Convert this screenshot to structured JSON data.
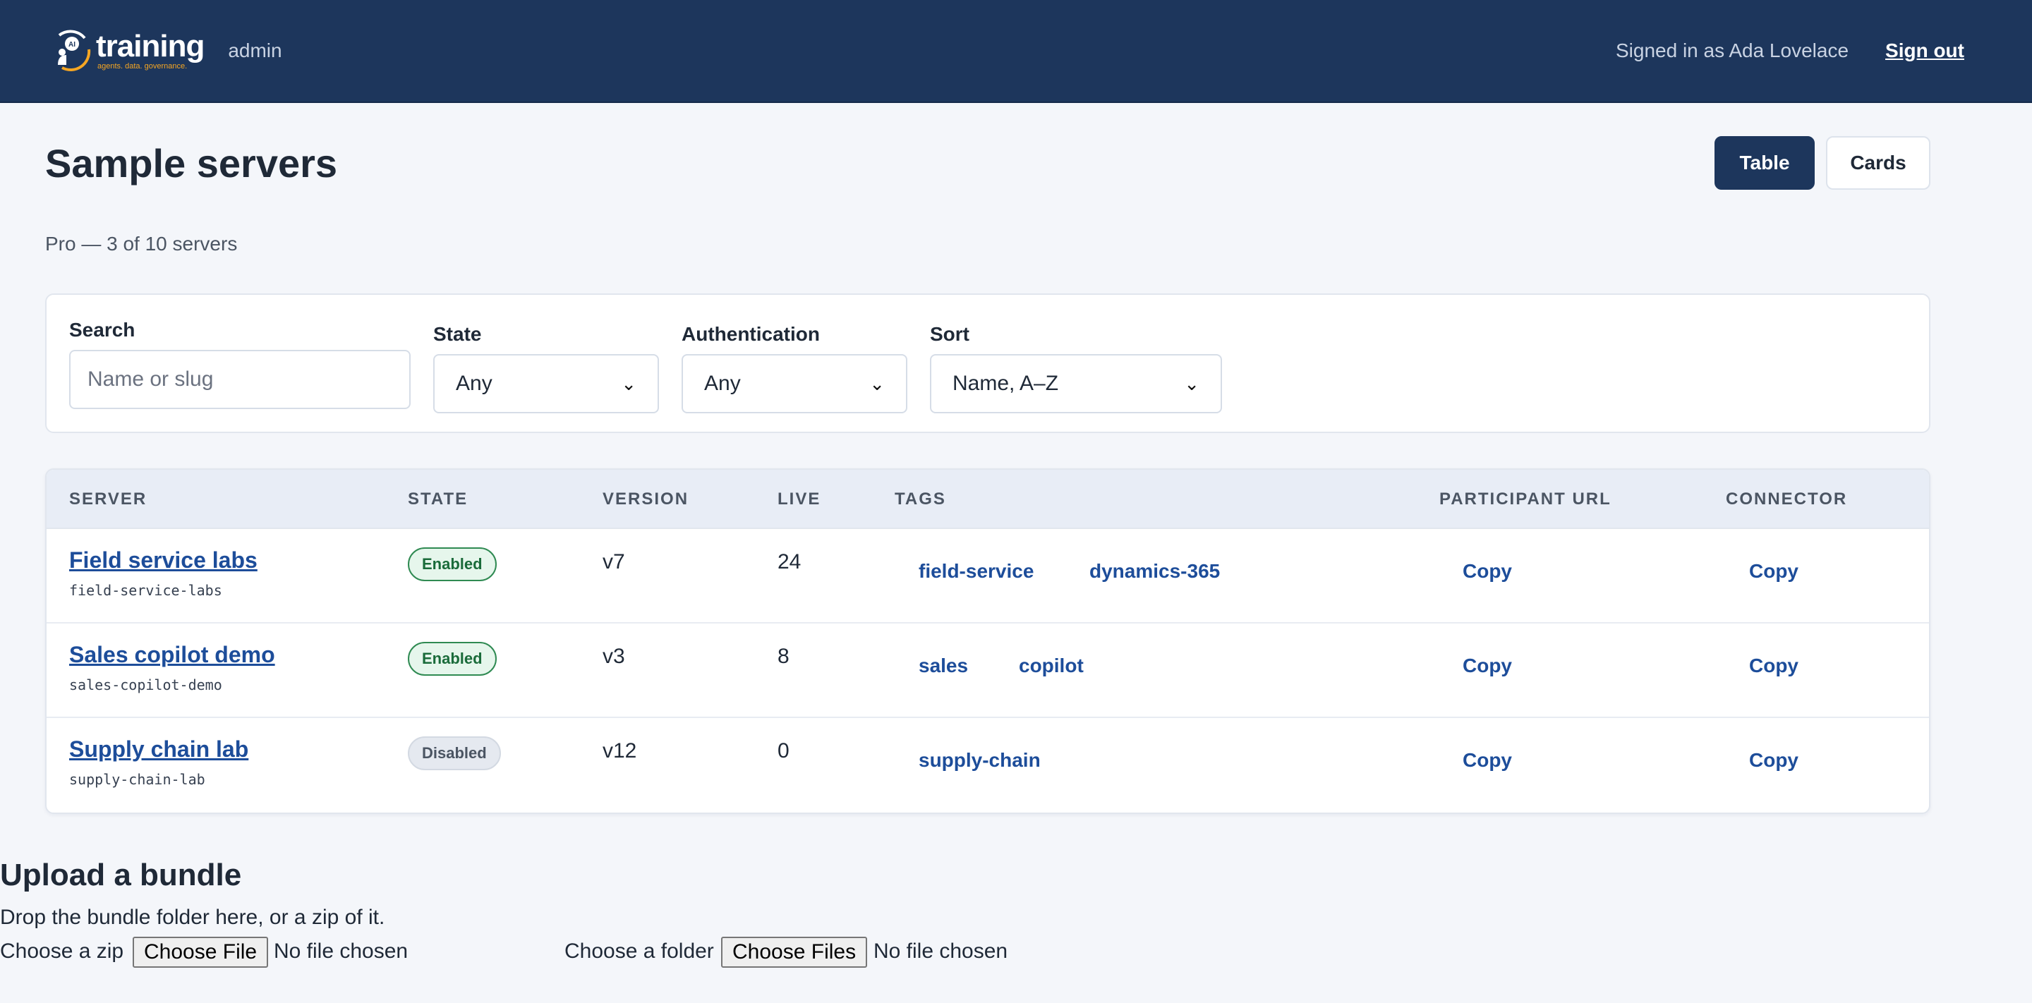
{
  "header": {
    "logo_word": "training",
    "logo_badge": "AI",
    "logo_sub": "agents. data. governance.",
    "admin_label": "admin",
    "signed_in_text": "Signed in as Ada Lovelace",
    "signout_label": "Sign out"
  },
  "page": {
    "title": "Sample servers",
    "subtitle": "Pro — 3 of 10 servers",
    "view_toggle": {
      "table_label": "Table",
      "cards_label": "Cards",
      "active": "Table"
    }
  },
  "filters": {
    "search_label": "Search",
    "search_placeholder": "Name or slug",
    "state_label": "State",
    "state_value": "Any",
    "auth_label": "Authentication",
    "auth_value": "Any",
    "sort_label": "Sort",
    "sort_value": "Name, A–Z"
  },
  "table": {
    "headers": {
      "server": "SERVER",
      "state": "STATE",
      "version": "VERSION",
      "live": "LIVE",
      "tags": "TAGS",
      "participant_url": "PARTICIPANT URL",
      "connector": "CONNECTOR"
    },
    "rows": [
      {
        "name": "Field service labs",
        "slug": "field-service-labs",
        "state": "Enabled",
        "version": "v7",
        "live": "24",
        "tags": [
          "field-service",
          "dynamics-365"
        ],
        "participant_url": "Copy",
        "connector": "Copy"
      },
      {
        "name": "Sales copilot demo",
        "slug": "sales-copilot-demo",
        "state": "Enabled",
        "version": "v3",
        "live": "8",
        "tags": [
          "sales",
          "copilot"
        ],
        "participant_url": "Copy",
        "connector": "Copy"
      },
      {
        "name": "Supply chain lab",
        "slug": "supply-chain-lab",
        "state": "Disabled",
        "version": "v12",
        "live": "0",
        "tags": [
          "supply-chain"
        ],
        "participant_url": "Copy",
        "connector": "Copy"
      }
    ]
  },
  "upload": {
    "title": "Upload a bundle",
    "description": "Drop the bundle folder here, or a zip of it.",
    "zip_label": "Choose a zip",
    "zip_button": "Choose File",
    "zip_status": "No file chosen",
    "folder_label": "Choose a folder",
    "folder_button": "Choose Files",
    "folder_status": "No file chosen"
  },
  "colors": {
    "header_bg": "#1d365c",
    "accent": "#1d4d9a",
    "logo_orange": "#f5a623",
    "enabled_green": "#1a6b3a"
  }
}
